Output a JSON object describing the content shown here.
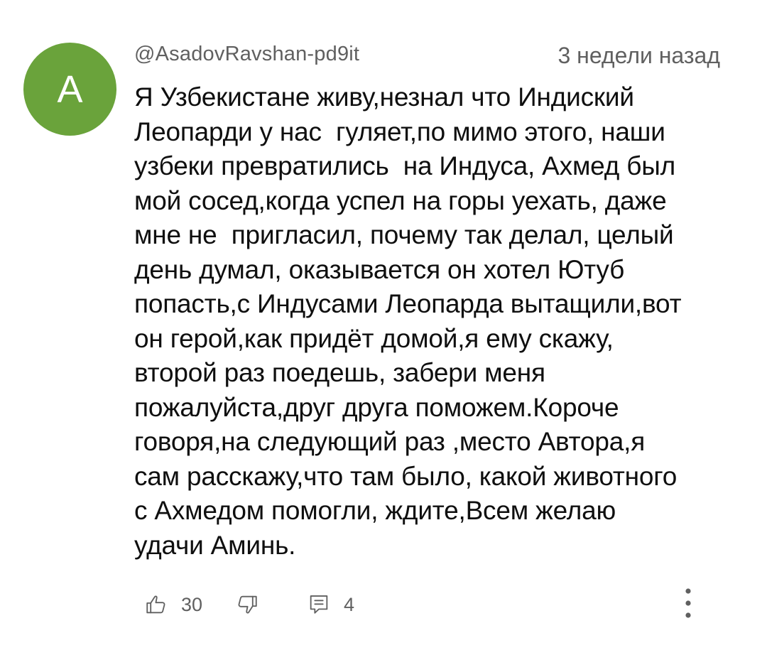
{
  "comment": {
    "avatar": {
      "initial": "A",
      "background_color": "#6aa33b"
    },
    "author": "@AsadovRavshan-pd9it",
    "timestamp": "3 недели назад",
    "text_lines": [
      "Я Узбекистане живу,незнал что Индиский",
      "Леопарди у нас  гуляет,по мимо этого, наши",
      "узбеки превратились  на Индуса, Ахмед был",
      "мой сосед,когда успел на горы уехать, даже",
      "мне не  пригласил, почему так делал, целый",
      "день думал, оказывается он хотел Ютуб",
      "попасть,с Индусами Леопарда вытащили,вот",
      "он герой,как придёт домой,я ему скажу,",
      "второй раз поедешь, забери меня",
      "пожалуйста,друг друга поможем.Короче",
      "говоря,на следующий раз ,место Автора,я",
      "сам расскажу,что там было, какой животного",
      "с Ахмедом помогли, ждите,Всем желаю",
      "удачи Аминь."
    ],
    "actions": {
      "like_icon": "thumbs-up-icon",
      "like_count": "30",
      "dislike_icon": "thumbs-down-icon",
      "reply_icon": "comment-icon",
      "reply_count": "4",
      "more_icon": "more-vertical-icon"
    }
  }
}
